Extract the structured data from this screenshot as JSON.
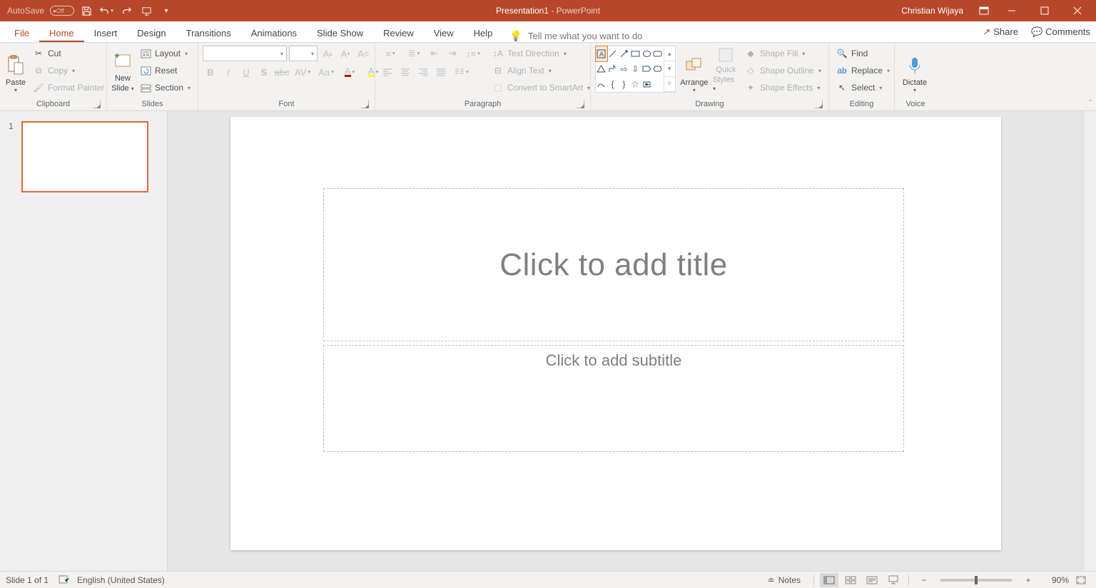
{
  "titlebar": {
    "autosave_label": "AutoSave",
    "autosave_state": "Off",
    "doc_title": "Presentation1",
    "app_title": " - PowerPoint",
    "user_name": "Christian Wijaya"
  },
  "tabs": {
    "file": "File",
    "items": [
      "Home",
      "Insert",
      "Design",
      "Transitions",
      "Animations",
      "Slide Show",
      "Review",
      "View",
      "Help"
    ],
    "active_index": 0,
    "tell_me": "Tell me what you want to do",
    "share": "Share",
    "comments": "Comments"
  },
  "ribbon": {
    "clipboard": {
      "paste": "Paste",
      "cut": "Cut",
      "copy": "Copy",
      "format_painter": "Format Painter",
      "caption": "Clipboard"
    },
    "slides": {
      "new_slide_line1": "New",
      "new_slide_line2": "Slide",
      "layout": "Layout",
      "reset": "Reset",
      "section": "Section",
      "caption": "Slides"
    },
    "font": {
      "caption": "Font"
    },
    "paragraph": {
      "text_direction": "Text Direction",
      "align_text": "Align Text",
      "convert_smartart": "Convert to SmartArt",
      "caption": "Paragraph"
    },
    "drawing": {
      "arrange": "Arrange",
      "quick_styles_l1": "Quick",
      "quick_styles_l2": "Styles",
      "shape_fill": "Shape Fill",
      "shape_outline": "Shape Outline",
      "shape_effects": "Shape Effects",
      "caption": "Drawing"
    },
    "editing": {
      "find": "Find",
      "replace": "Replace",
      "select": "Select",
      "caption": "Editing"
    },
    "voice": {
      "dictate": "Dictate",
      "caption": "Voice"
    }
  },
  "slide": {
    "number": "1",
    "title_placeholder": "Click to add title",
    "subtitle_placeholder": "Click to add subtitle"
  },
  "status": {
    "slide_info": "Slide 1 of 1",
    "language": "English (United States)",
    "notes": "Notes",
    "zoom_percent": "90%"
  }
}
